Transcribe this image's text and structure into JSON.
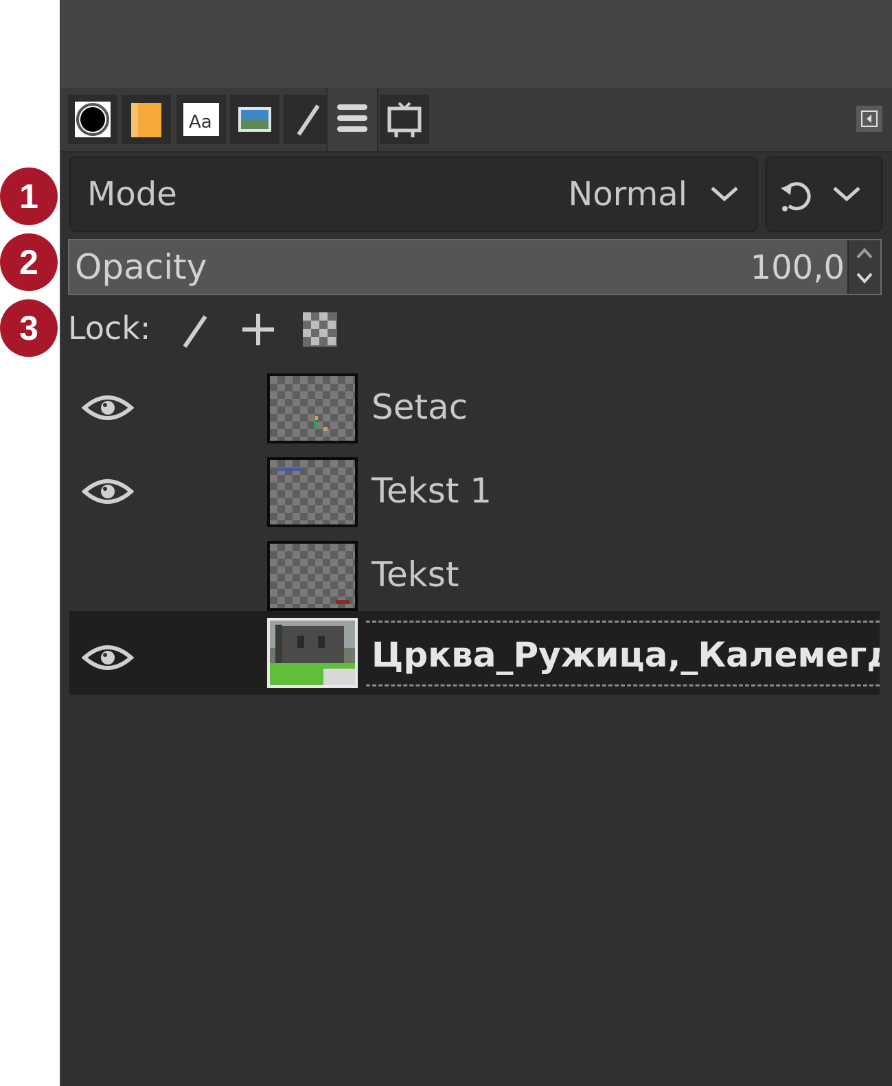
{
  "tabs": [
    {
      "name": "brush-tab",
      "icon": "brush-icon"
    },
    {
      "name": "pattern-tab",
      "icon": "pattern-icon"
    },
    {
      "name": "fonts-tab",
      "icon": "fonts-icon",
      "label": "Aa"
    },
    {
      "name": "images-tab",
      "icon": "image-icon"
    },
    {
      "name": "paths-tab",
      "icon": "pen-icon"
    },
    {
      "name": "layers-tab",
      "icon": "layers-icon",
      "active": true
    },
    {
      "name": "device-tab",
      "icon": "device-icon"
    }
  ],
  "mode": {
    "label": "Mode",
    "value": "Normal"
  },
  "opacity": {
    "label": "Opacity",
    "value": "100,0"
  },
  "lock": {
    "label": "Lock:"
  },
  "layers": [
    {
      "name": "Setac",
      "visible": true
    },
    {
      "name": "Tekst 1",
      "visible": true
    },
    {
      "name": "Tekst",
      "visible": false
    },
    {
      "name": "Црква_Ружица,_Калемегд",
      "visible": true,
      "selected": true
    }
  ],
  "callouts": [
    "1",
    "2",
    "3"
  ],
  "colors": {
    "panel": "#303030",
    "callout": "#a8182a",
    "accent_orange": "#f6a83a"
  }
}
